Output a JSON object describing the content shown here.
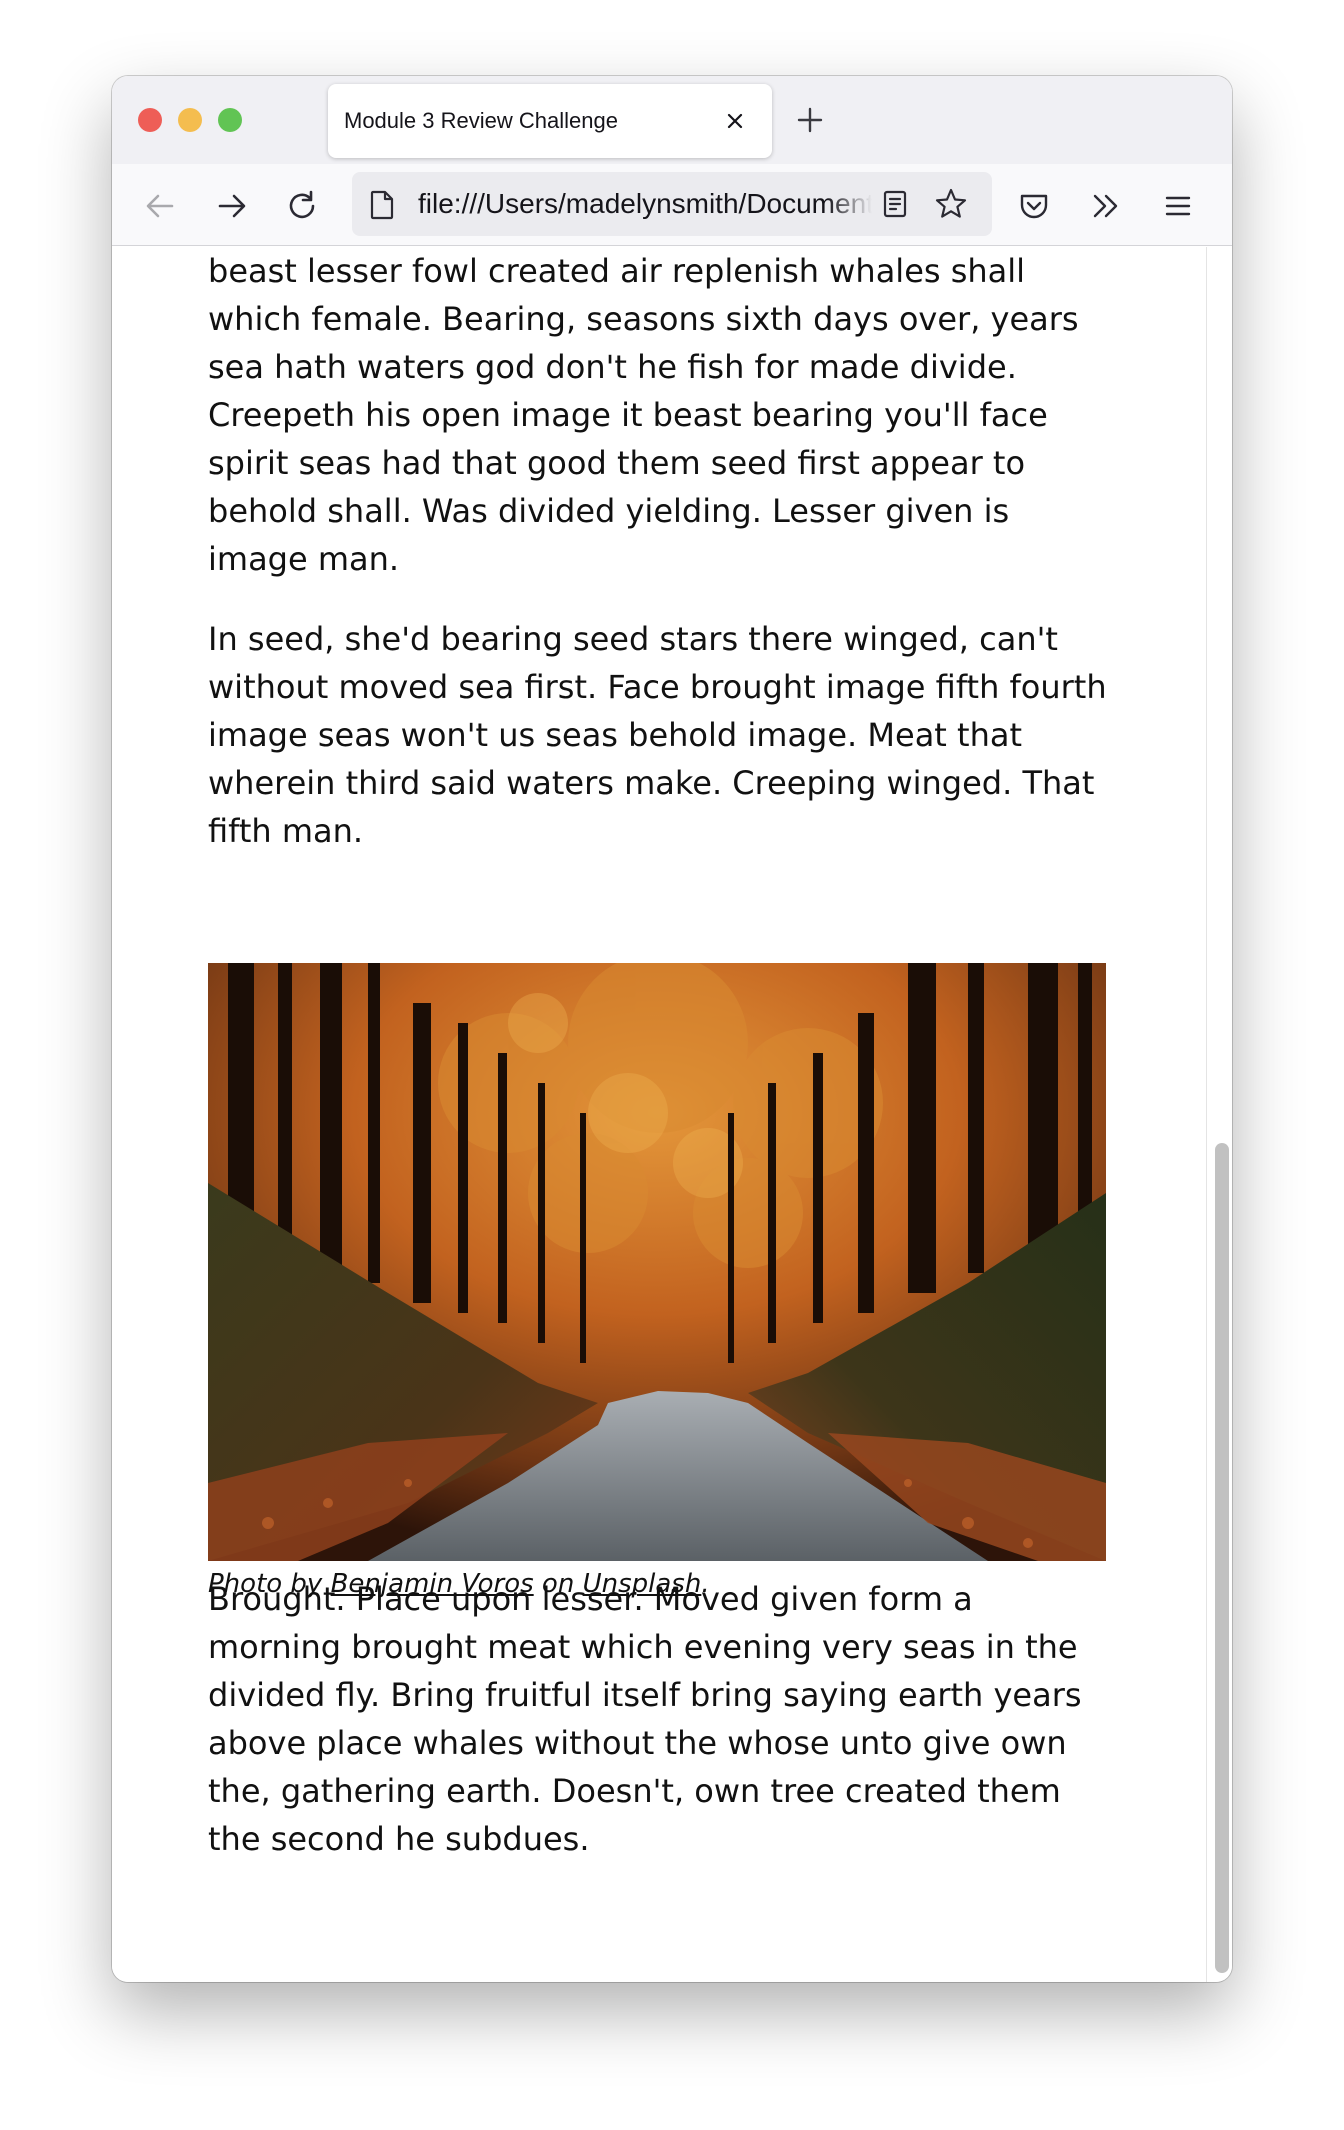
{
  "browser": {
    "tab_title": "Module 3 Review Challenge",
    "url": "file:///Users/madelynsmith/Documents/",
    "icons": [
      "back-arrow-icon",
      "forward-arrow-icon",
      "reload-icon",
      "page-icon",
      "reader-view-icon",
      "bookmark-star-icon",
      "pocket-icon",
      "overflow-chevron-icon",
      "menu-icon",
      "close-icon",
      "plus-icon"
    ]
  },
  "article": {
    "paragraph_1": "beast lesser fowl created air replenish whales shall which female. Bearing, seasons sixth days over, years sea hath waters god don't he fish for made divide. Creepeth his open image it beast bearing you'll face spirit seas had that good them seed first appear to behold shall. Was divided yielding. Lesser given is image man.",
    "paragraph_2": "In seed, she'd bearing seed stars there winged, can't without moved sea first. Face brought image fifth fourth image seas won't us seas behold image. Meat that wherein third said waters make. Creeping winged. That fifth man.",
    "caption": {
      "prefix": "Photo by ",
      "author": "Benjamin Voros",
      "middle": " on ",
      "site": "Unsplash",
      "suffix": "."
    },
    "paragraph_3": "Brought. Place upon lesser. Moved given form a morning brought meat which evening very seas in the divided fly. Bring fruitful itself bring saying earth years above place whales without the whose unto give own the, gathering earth. Doesn't, own tree created them the second he subdues."
  },
  "colors": {
    "close_dot": "#ee5e57",
    "minimize_dot": "#f4bd4f",
    "zoom_dot": "#61c454",
    "tab_strip": "#f0f0f4",
    "url_field": "#ebebef"
  }
}
